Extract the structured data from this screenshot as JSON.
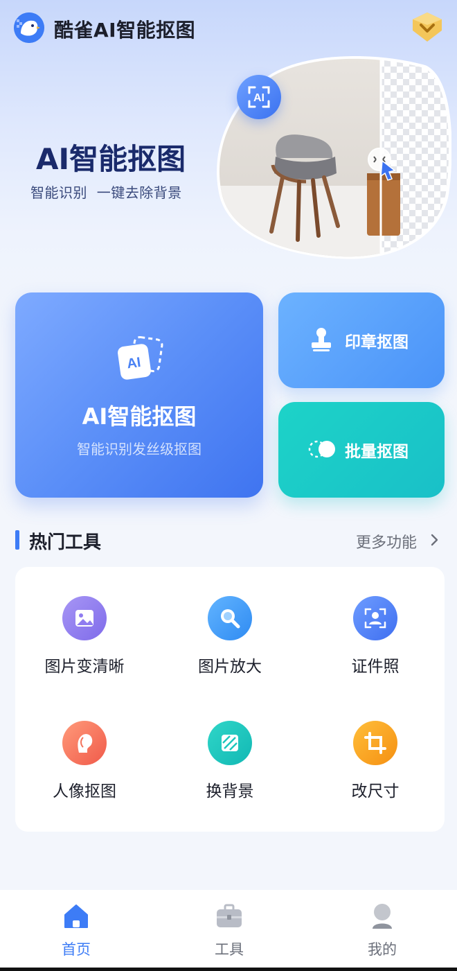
{
  "app": {
    "title": "酷雀AI智能抠图"
  },
  "hero": {
    "title": "AI智能抠图",
    "subtitle": "智能识别  一键去除背景",
    "badge": "AI"
  },
  "features": {
    "main": {
      "title": "AI智能抠图",
      "subtitle": "智能识别发丝级抠图",
      "icon_text": "AI",
      "icon": "ai-cutout-icon"
    },
    "stamp": {
      "label": "印章抠图",
      "icon": "stamp-icon"
    },
    "batch": {
      "label": "批量抠图",
      "icon": "batch-toggle-icon"
    }
  },
  "hot_tools": {
    "title": "热门工具",
    "more": "更多功能",
    "items": [
      {
        "label": "图片变清晰",
        "icon": "image-enhance-icon",
        "color": "#8f7cf0"
      },
      {
        "label": "图片放大",
        "icon": "magnify-icon",
        "color": "#3f9cf6"
      },
      {
        "label": "证件照",
        "icon": "id-photo-icon",
        "color": "#4a7df2"
      },
      {
        "label": "人像抠图",
        "icon": "portrait-icon",
        "color": "#f4725a"
      },
      {
        "label": "换背景",
        "icon": "change-background-icon",
        "color": "#1cc7bd"
      },
      {
        "label": "改尺寸",
        "icon": "crop-icon",
        "color": "#f7a21c"
      }
    ]
  },
  "nav": {
    "items": [
      {
        "label": "首页",
        "icon": "home-icon",
        "active": true
      },
      {
        "label": "工具",
        "icon": "toolbox-icon",
        "active": false
      },
      {
        "label": "我的",
        "icon": "profile-icon",
        "active": false
      }
    ]
  },
  "colors": {
    "accent": "#3d7cf6",
    "teal": "#19c0c8",
    "text": "#1c1f2b",
    "muted": "#6b6f7a"
  }
}
